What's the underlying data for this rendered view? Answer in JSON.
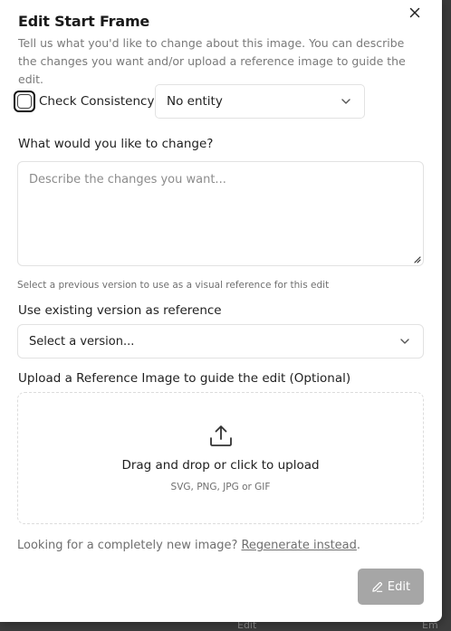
{
  "dialog": {
    "title": "Edit Start Frame",
    "description": "Tell us what you'd like to change about this image. You can describe the changes you want and/or upload a reference image to guide the edit."
  },
  "consistency": {
    "label": "Check Consistency",
    "checked": false
  },
  "entity_select": {
    "value": "No entity"
  },
  "change": {
    "label": "What would you like to change?",
    "placeholder": "Describe the changes you want...",
    "value": ""
  },
  "reference": {
    "hint": "Select a previous version to use as a visual reference for this edit",
    "label": "Use existing version as reference",
    "select_value": "Select a version..."
  },
  "upload": {
    "label": "Upload a Reference Image to guide the edit (Optional)",
    "main_text": "Drag and drop or click to upload",
    "formats": "SVG, PNG, JPG or GIF"
  },
  "footer": {
    "prompt": "Looking for a completely new image? ",
    "link": "Regenerate instead",
    "period": "."
  },
  "edit_button": {
    "label": "Edit"
  },
  "background": {
    "ghost_left": "Edit",
    "ghost_right": "Em"
  },
  "icons": {
    "close": "close-icon",
    "chevron": "chevron-down-icon",
    "upload": "upload-icon",
    "pencil": "pencil-icon"
  },
  "colors": {
    "edit_button_bg": "#a6a6a6",
    "border": "#e2e2e2",
    "muted_text": "#6f6f6f"
  }
}
